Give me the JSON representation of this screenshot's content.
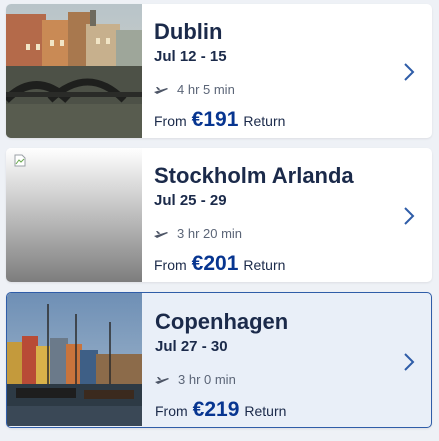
{
  "flights": [
    {
      "city": "Dublin",
      "dates": "Jul 12 - 15",
      "duration": "4 hr 5 min",
      "from_label": "From",
      "price": "€191",
      "return_label": "Return",
      "image": "dublin-photo"
    },
    {
      "city": "Stockholm Arlanda",
      "dates": "Jul 25 - 29",
      "duration": "3 hr 20 min",
      "from_label": "From",
      "price": "€201",
      "return_label": "Return",
      "image": "broken-image"
    },
    {
      "city": "Copenhagen",
      "dates": "Jul 27 - 30",
      "duration": "3 hr 0 min",
      "from_label": "From",
      "price": "€219",
      "return_label": "Return",
      "image": "copenhagen-photo"
    }
  ],
  "colors": {
    "title": "#1b2a4a",
    "price": "#073590",
    "chevron": "#2f5da8",
    "selected_bg": "#e9eff8"
  },
  "icons": [
    "plane-icon",
    "chevron-right-icon",
    "broken-image-icon"
  ]
}
